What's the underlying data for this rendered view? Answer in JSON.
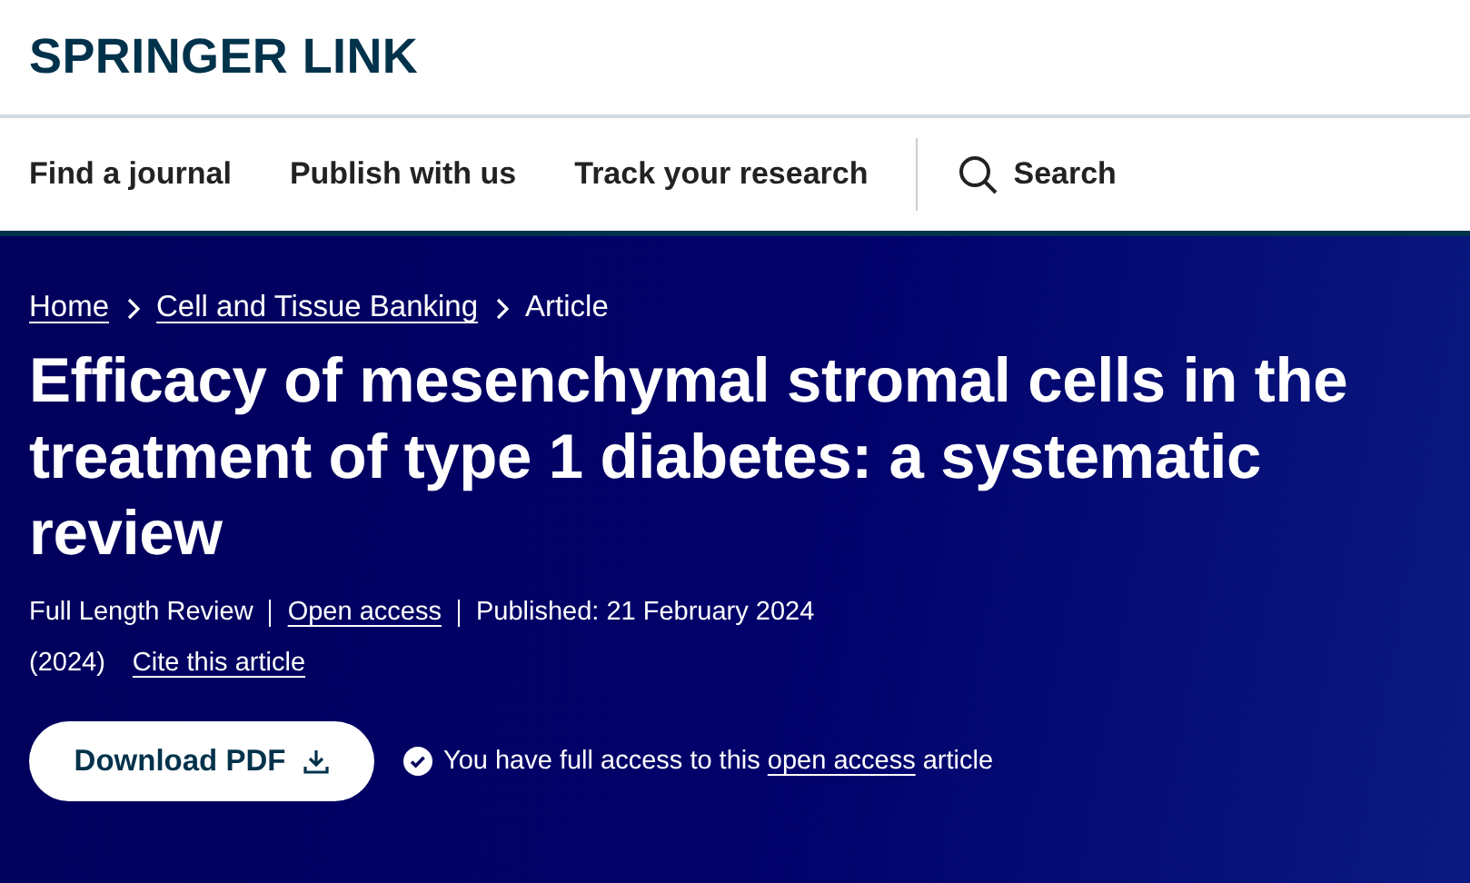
{
  "logo": "SPRINGER LINK",
  "nav": [
    {
      "label": "Find a journal"
    },
    {
      "label": "Publish with us"
    },
    {
      "label": "Track your research"
    }
  ],
  "search": {
    "label": "Search"
  },
  "breadcrumb": [
    {
      "label": "Home",
      "link": true
    },
    {
      "label": "Cell and Tissue Banking",
      "link": true
    },
    {
      "label": "Article",
      "link": false
    }
  ],
  "title": "Efficacy of mesenchymal stromal cells in the treatment of type 1 diabetes: a systematic review",
  "meta": [
    {
      "text": "Full Length Review",
      "link": false
    },
    {
      "text": "Open access",
      "link": true
    },
    {
      "text": "Published: 21 February 2024",
      "link": false
    }
  ],
  "year": "(2024)",
  "cite": "Cite this article",
  "download": "Download PDF",
  "access": {
    "before": "You have full access to this",
    "link": "open access",
    "after": "article"
  }
}
